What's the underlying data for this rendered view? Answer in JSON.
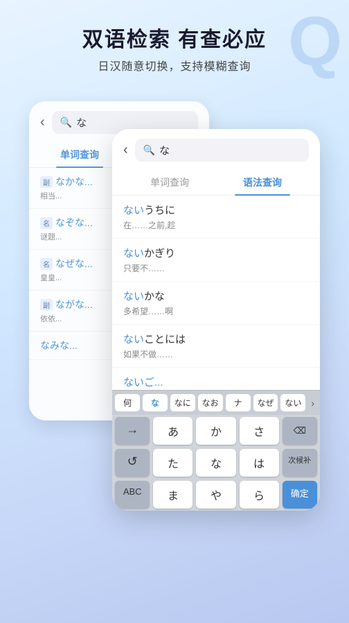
{
  "header": {
    "title": "双语检索 有查必应",
    "subtitle": "日汉随意切换，支持模糊查询"
  },
  "watermark": "Q",
  "back_phone": {
    "search_value": "な",
    "tabs": [
      {
        "label": "单词查询",
        "active": true
      },
      {
        "label": "语法查询",
        "active": false
      }
    ],
    "items": [
      {
        "jp": "なかな...",
        "tag": "副",
        "cn": "相当..."
      },
      {
        "jp": "なぞな...",
        "tag": "名",
        "cn": "谜题..."
      },
      {
        "jp": "なぜな...",
        "tag": "名",
        "cn": "皇皇..."
      },
      {
        "jp": "ながな...",
        "tag": "副",
        "cn": "依依..."
      },
      {
        "jp": "なみな...",
        "cn": ""
      }
    ]
  },
  "front_phone": {
    "search_value": "な",
    "tabs": [
      {
        "label": "单词查询",
        "active": false
      },
      {
        "label": "语法查询",
        "active": true
      }
    ],
    "items": [
      {
        "jp": "ないうちに",
        "cn": "在……之前,趁"
      },
      {
        "jp": "ないかぎり",
        "cn": "只要不……"
      },
      {
        "jp": "ないかな",
        "cn": "多希望……啊"
      },
      {
        "jp": "ないことには",
        "cn": "如果不做……"
      },
      {
        "jp": "ないご...",
        "cn": ""
      }
    ],
    "keyboard": {
      "top_row": [
        "何",
        "な",
        "なに",
        "なお",
        "ナ",
        "なぜ",
        "ない",
        "▸"
      ],
      "rows": [
        [
          "→",
          "あ",
          "か",
          "さ",
          "⌫"
        ],
        [
          "↺",
          "た",
          "な",
          "は",
          "次候补"
        ],
        [
          "ABC",
          "ま",
          "や",
          "ら",
          "确定"
        ]
      ]
    }
  }
}
